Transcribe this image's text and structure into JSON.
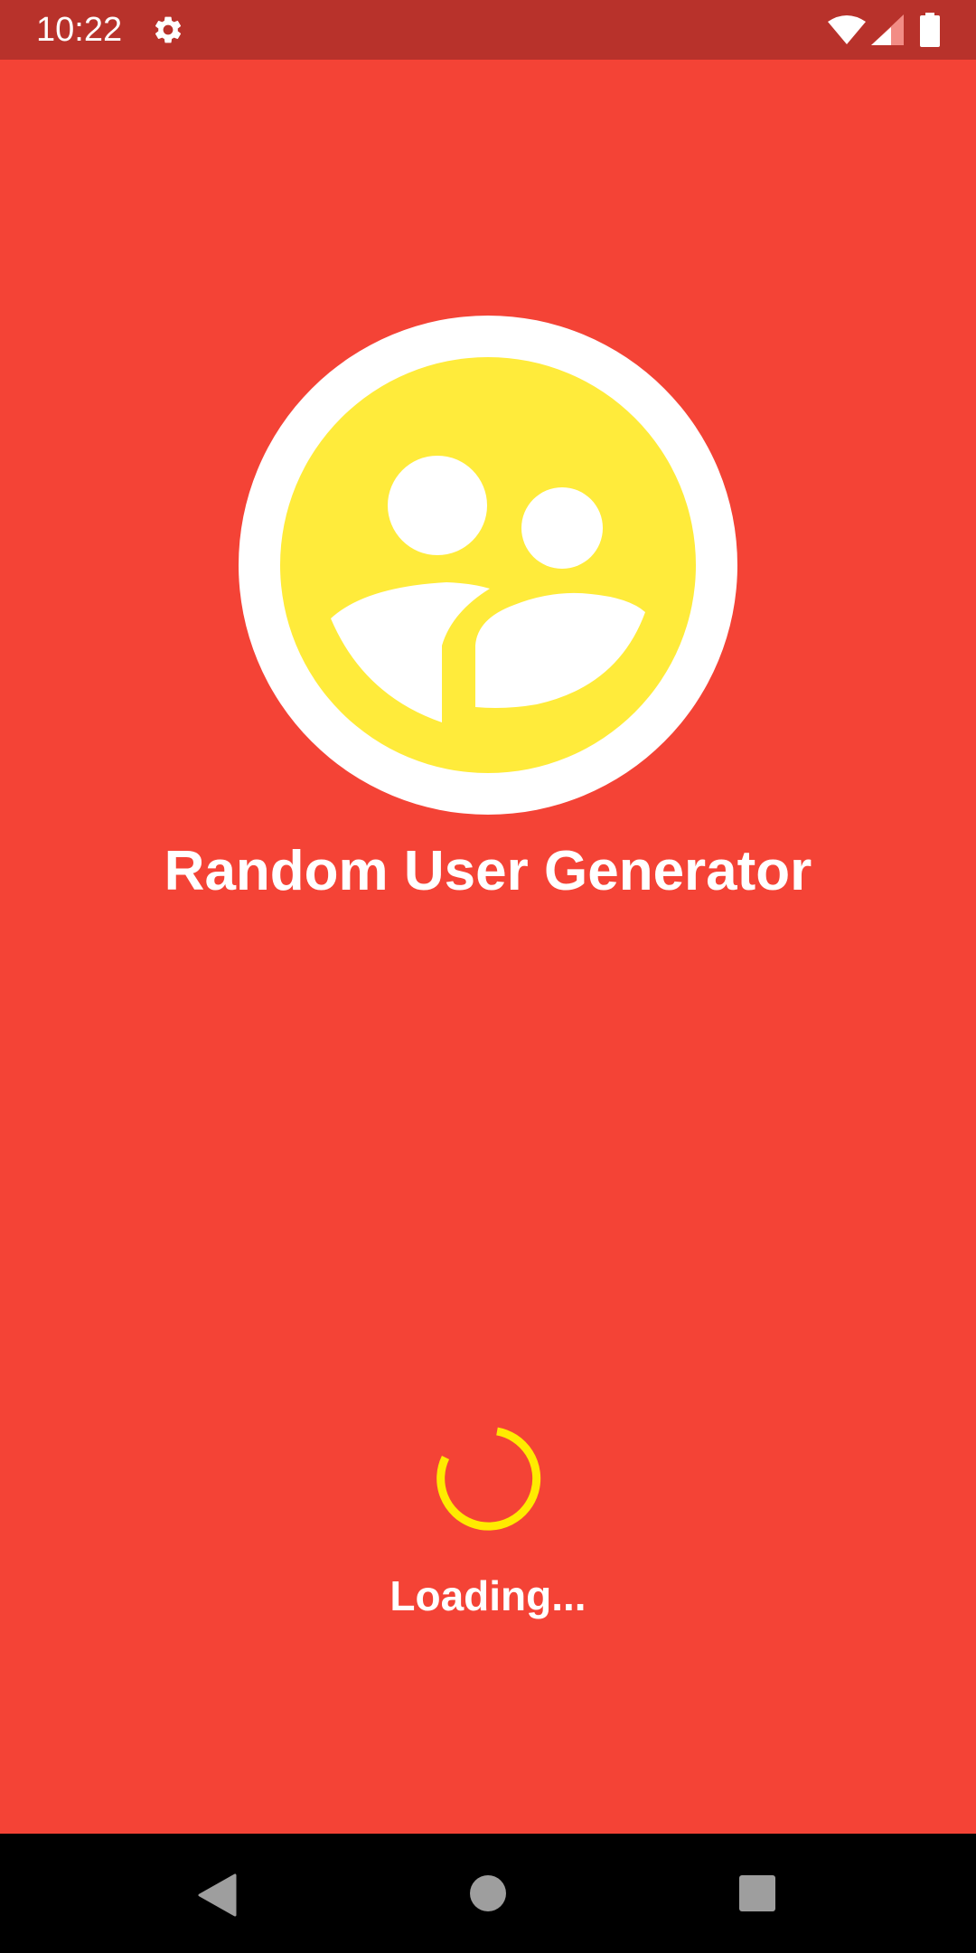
{
  "status_bar": {
    "time": "10:22",
    "icons": [
      "gear-icon",
      "wifi-icon",
      "signal-icon",
      "battery-icon"
    ]
  },
  "app": {
    "title": "Random User Generator",
    "loading_text": "Loading...",
    "logo_icon": "users-group-icon",
    "spinner_icon": "progress-spinner-icon"
  },
  "nav_bar": {
    "icons": [
      "back-icon",
      "home-icon",
      "recents-icon"
    ]
  },
  "colors": {
    "background": "#f44336",
    "status_bar": "#b8322b",
    "logo_face": "#ffeb3b",
    "logo_ring": "#ffffff",
    "spinner": "#ffeb00",
    "text": "#ffffff",
    "nav_bar": "#000000",
    "nav_buttons": "#9e9e9e"
  }
}
